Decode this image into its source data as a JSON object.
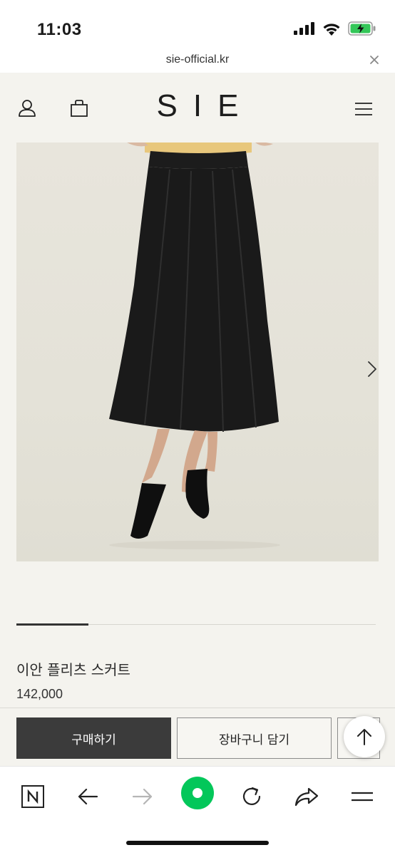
{
  "status_bar": {
    "time": "11:03",
    "battery_color": "#34c759"
  },
  "browser": {
    "url": "sie-official.kr"
  },
  "site": {
    "logo": "SIE",
    "background": "#f4f3ee"
  },
  "product": {
    "name": "이안 플리츠 스커트",
    "price": "142,000",
    "gallery_progress": 0.2
  },
  "actions": {
    "buy_label": "구매하기",
    "cart_label": "장바구니 담기"
  },
  "toolbar": {
    "icons": [
      "naver-n-icon",
      "back-arrow-icon",
      "forward-arrow-icon",
      "green-dot-icon",
      "refresh-icon",
      "share-icon",
      "menu-icon"
    ],
    "accent": "#03c75a"
  }
}
